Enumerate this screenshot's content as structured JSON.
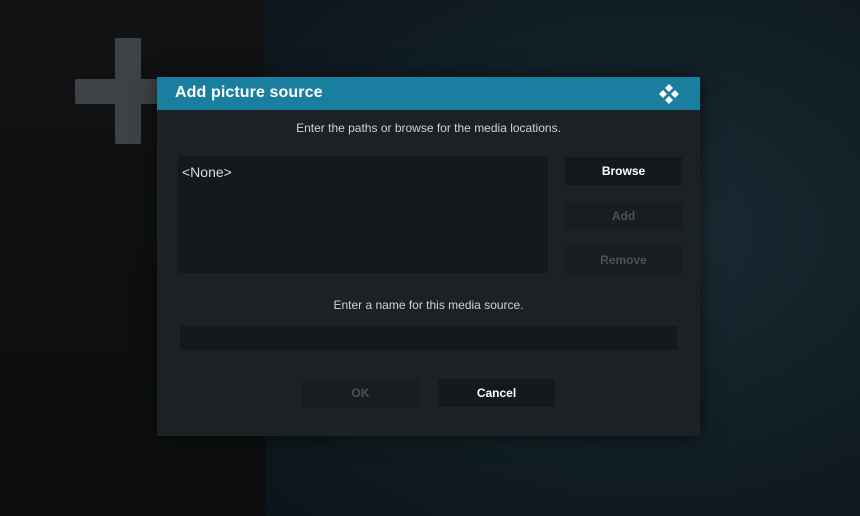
{
  "dialog": {
    "title": "Add picture source",
    "logo_icon": "kodi-logo-icon",
    "header_color": "#1a7f9e",
    "paths_instruction": "Enter the paths or browse for the media locations.",
    "paths": [
      "<None>"
    ],
    "buttons": {
      "browse": "Browse",
      "add": "Add",
      "remove": "Remove",
      "ok": "OK",
      "cancel": "Cancel"
    },
    "name_instruction": "Enter a name for this media source.",
    "name_value": ""
  },
  "background": {
    "add_icon": "plus-icon"
  }
}
